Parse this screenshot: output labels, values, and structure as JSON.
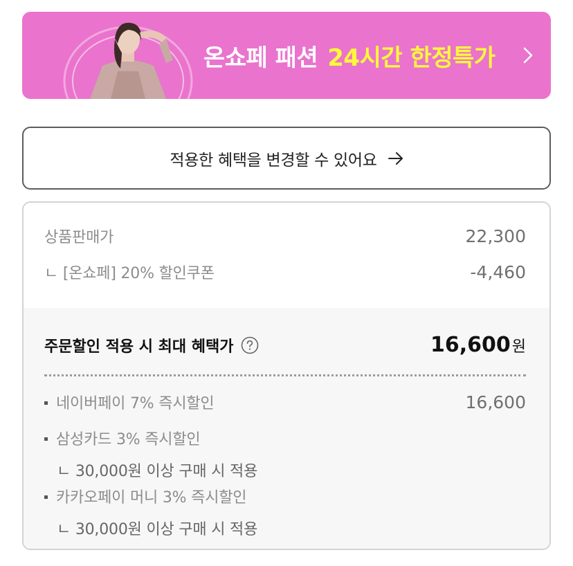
{
  "banner": {
    "title": "온쇼페 패션",
    "highlight": "24시간 한정특가",
    "colors": {
      "background": "#ea73cd",
      "highlight": "#fff83b"
    }
  },
  "benefit_change": {
    "label": "적용한 혜택을 변경할 수 있어요"
  },
  "price": {
    "sale_label": "상품판매가",
    "sale_value": "22,300",
    "coupon_label": "ㄴ [온쇼페] 20% 할인쿠폰",
    "coupon_value": "-4,460"
  },
  "max_benefit": {
    "label": "주문할인 적용 시 최대 혜택가",
    "value": "16,600",
    "unit": "원"
  },
  "discounts": [
    {
      "label": "네이버페이 7% 즉시할인",
      "value": "16,600",
      "condition": ""
    },
    {
      "label": "삼성카드 3% 즉시할인",
      "value": "",
      "condition": "ㄴ 30,000원 이상 구매 시 적용"
    },
    {
      "label": "카카오페이 머니 3% 즉시할인",
      "value": "",
      "condition": "ㄴ 30,000원 이상 구매 시 적용"
    }
  ]
}
